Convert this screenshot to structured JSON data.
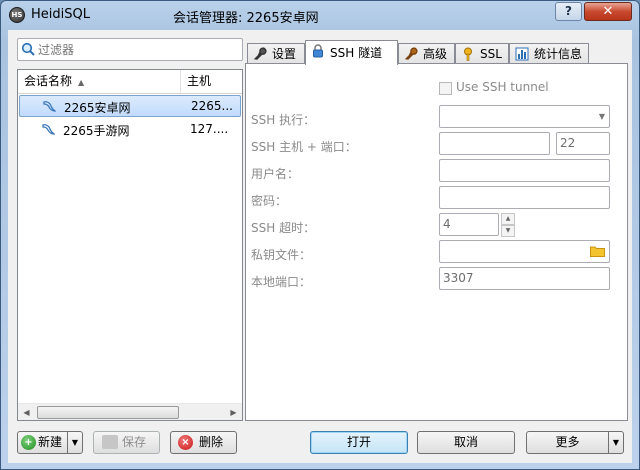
{
  "window": {
    "app_icon_text": "HS",
    "app_name": "HeidiSQL",
    "title": "会话管理器: 2265安卓网",
    "help_label": "?",
    "close_label": "✕"
  },
  "filter": {
    "placeholder": "过滤器"
  },
  "session_list": {
    "columns": [
      "会话名称",
      "主机"
    ],
    "sort_arrow": "▲",
    "rows": [
      {
        "name": "2265安卓网",
        "host": "2265...",
        "selected": true
      },
      {
        "name": "2265手游网",
        "host": "127....",
        "selected": false
      }
    ],
    "scroll_left": "◀",
    "scroll_right": "▶"
  },
  "left_buttons": {
    "new_label": "新建",
    "new_dropdown": "▼",
    "save_label": "保存",
    "delete_label": "删除"
  },
  "tabs": [
    {
      "label": "设置",
      "icon": "wrench-icon",
      "active": false
    },
    {
      "label": "SSH 隧道",
      "icon": "lock-icon",
      "active": true
    },
    {
      "label": "高级",
      "icon": "wrench-icon",
      "active": false
    },
    {
      "label": "SSL",
      "icon": "key-icon",
      "active": false
    },
    {
      "label": "统计信息",
      "icon": "bar-chart-icon",
      "active": false
    }
  ],
  "ssh_form": {
    "use_ssh_label": "Use SSH tunnel",
    "use_ssh_checked": false,
    "executable_label": "SSH 执行：",
    "executable_value": "",
    "dropdown_arrow": "▼",
    "host_port_label": "SSH 主机 + 端口：",
    "host_value": "",
    "port_value": "22",
    "username_label": "用户名：",
    "username_value": "",
    "password_label": "密码：",
    "password_value": "",
    "timeout_label": "SSH 超时：",
    "timeout_value": "4",
    "spin_up": "▲",
    "spin_down": "▼",
    "keyfile_label": "私钥文件：",
    "keyfile_value": "",
    "local_port_label": "本地端口：",
    "local_port_value": "3307"
  },
  "right_buttons": {
    "open_label": "打开",
    "cancel_label": "取消",
    "more_label": "更多",
    "more_dropdown": "▼"
  },
  "colors": {
    "accent_selection": "#c1dbfc",
    "close_red": "#c84a30",
    "folder_yellow": "#f4c430"
  }
}
